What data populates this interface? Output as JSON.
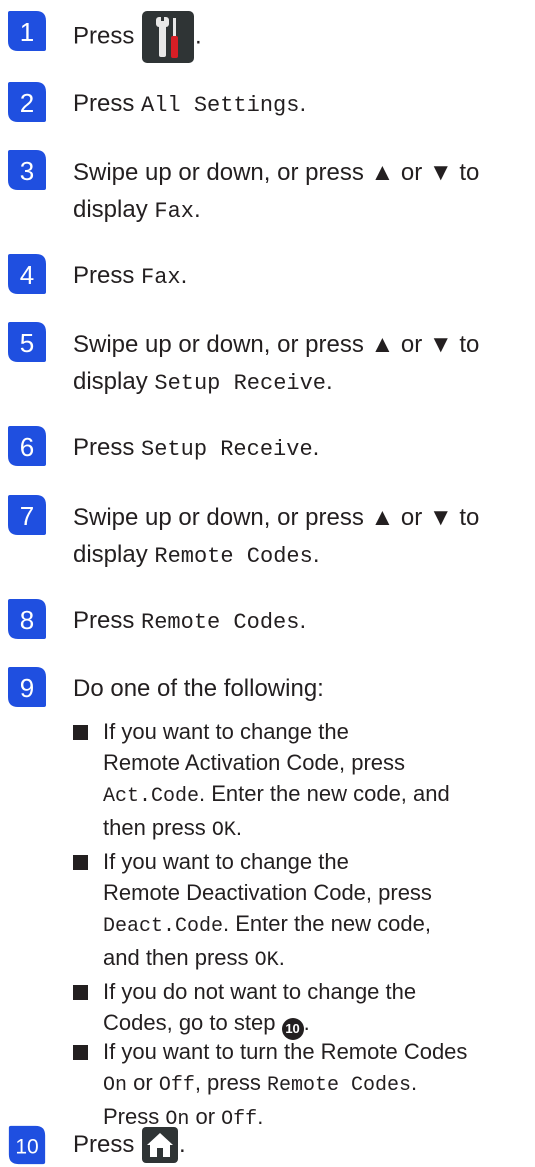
{
  "steps": [
    {
      "n": "1",
      "pre": "Press",
      "icon": "settings-icon",
      "post": "."
    },
    {
      "n": "2",
      "pre": "Press ",
      "code": "All Settings",
      "post": "."
    },
    {
      "n": "3",
      "l1": "Swipe up or down, or press ▲ or ▼ to",
      "l2pre": "display ",
      "code": "Fax",
      "post": "."
    },
    {
      "n": "4",
      "pre": "Press ",
      "code": "Fax",
      "post": "."
    },
    {
      "n": "5",
      "l1": "Swipe up or down, or press ▲ or ▼ to",
      "l2pre": "display ",
      "code": "Setup Receive",
      "post": "."
    },
    {
      "n": "6",
      "pre": "Press ",
      "code": "Setup Receive",
      "post": "."
    },
    {
      "n": "7",
      "l1": "Swipe up or down, or press ▲ or ▼ to",
      "l2pre": "display ",
      "code": "Remote Codes",
      "post": "."
    },
    {
      "n": "8",
      "pre": "Press ",
      "code": "Remote Codes",
      "post": "."
    },
    {
      "n": "9",
      "text": "Do one of the following:"
    },
    {
      "n": "10",
      "pre": "Press",
      "icon": "home-icon",
      "post": "."
    }
  ],
  "bullets": [
    {
      "l1": "If you want to change the",
      "l2a": "Remote Activation Code, press",
      "l3code": "Act.Code",
      "l3post": ". Enter the new code, and",
      "l4pre": "then press ",
      "l4code": "OK",
      "l4post": "."
    },
    {
      "l1": "If you want to change the",
      "l2a": "Remote Deactivation Code, press",
      "l3code": "Deact.Code",
      "l3post": ". Enter the new code,",
      "l4pre": "and then press ",
      "l4code": "OK",
      "l4post": "."
    },
    {
      "l1": "If you do not want to change the",
      "l2pre": "Codes, go to step ",
      "l2ref": "10",
      "l2post": "."
    },
    {
      "l1": "If you want to turn the Remote Codes",
      "l2code1": "On",
      "l2mid1": " or ",
      "l2code2": "Off",
      "l2mid2": ", press ",
      "l2code3": "Remote Codes",
      "l2post": ".",
      "l3pre": "Press ",
      "l3code1": "On",
      "l3mid": " or ",
      "l3code2": "Off",
      "l3post": "."
    }
  ],
  "colors": {
    "step_badge": "#1f4fe0",
    "text": "#231f20",
    "settings_screw": "#d71e25"
  }
}
